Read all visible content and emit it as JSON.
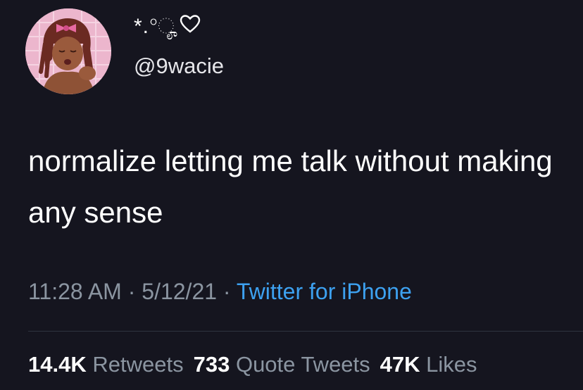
{
  "user": {
    "display_name": "*.°ೄ",
    "handle": "@9wacie",
    "avatar_icon": "anime-avatar"
  },
  "tweet": {
    "text": "normalize letting me talk without making any sense",
    "time": "11:28 AM",
    "date": "5/12/21",
    "separator": "·",
    "source": "Twitter for iPhone"
  },
  "stats": {
    "retweets_count": "14.4K",
    "retweets_label": "Retweets",
    "quotes_count": "733",
    "quotes_label": "Quote Tweets",
    "likes_count": "47K",
    "likes_label": "Likes"
  },
  "colors": {
    "background": "#15151f",
    "primary_text": "#ffffff",
    "secondary_text": "#8b95a1",
    "link": "#3da1f0"
  }
}
